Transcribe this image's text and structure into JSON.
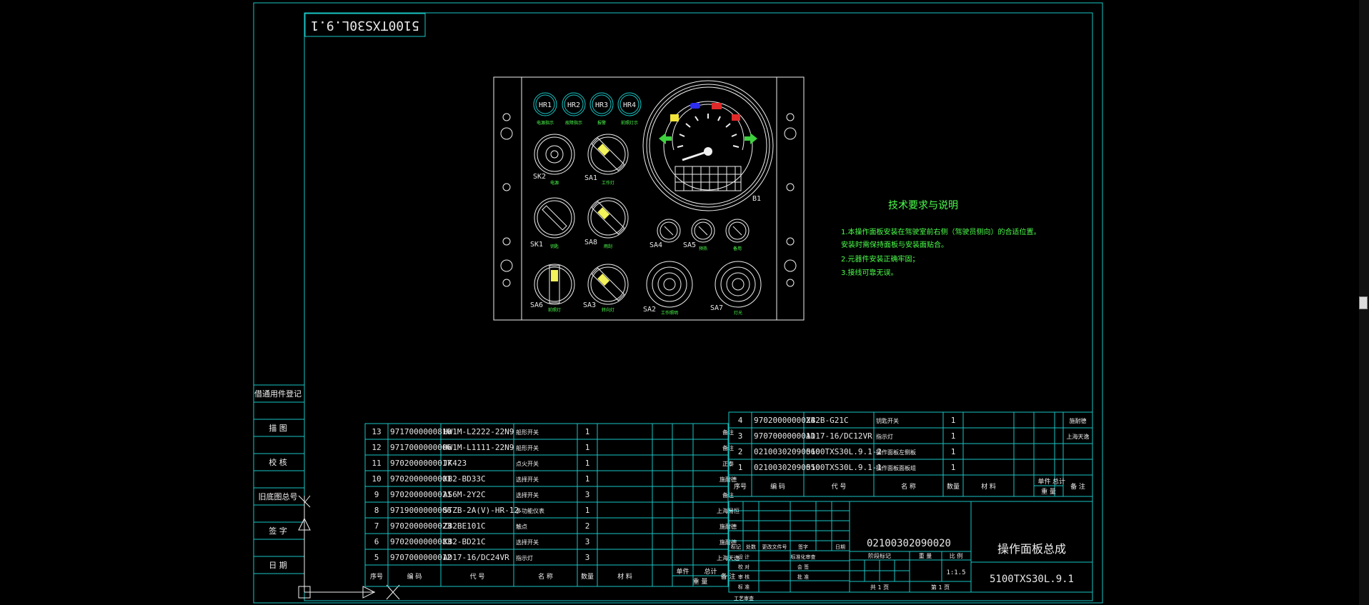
{
  "title_tag": "5100TXS30L.9.1",
  "tech": {
    "heading": "技术要求与说明",
    "lines": [
      "1.本操作面板安装在驾驶室前右侧（驾驶员侧向）的合适位置。",
      "   安装时需保持面板与安装面贴合。",
      "2.元器件安装正确牢固；",
      "3.接线可靠无误。"
    ]
  },
  "indicators": [
    "HR1",
    "HR2",
    "HR3",
    "HR4"
  ],
  "indicator_captions": [
    "电源指示",
    "故障指示",
    "报警",
    "前照灯示"
  ],
  "switch_labels": [
    "SK2",
    "SA1",
    "SK1",
    "SA8",
    "SA4",
    "SA5",
    "SA6",
    "SA3",
    "SA2",
    "SA7",
    "B1"
  ],
  "switch_captions": {
    "sk2": "电源",
    "sa1": "工作灯",
    "sk1": "钥匙",
    "sa8": "雨刮",
    "sa6": "前照灯",
    "sa3": "转向灯",
    "sa2": "工作照明",
    "sa7": "灯光",
    "sa4": "喇叭",
    "sa5": "预热",
    "sa6b": "备用"
  },
  "side_panel": [
    "借通用件登记",
    "描 图",
    "校 核",
    "旧底图总号",
    "签 字",
    "日 期"
  ],
  "bom_left": {
    "header": [
      "序号",
      "编 码",
      "代 号",
      "名 称",
      "数量",
      "材 料",
      "单件",
      "总计",
      "备 注"
    ],
    "header_weight": "重 量",
    "rows": [
      {
        "no": "13",
        "code": "9717000000810",
        "part": "HW1M-L2222-22N9",
        "name": "船形开关",
        "qty": "1",
        "note": "备注"
      },
      {
        "no": "12",
        "code": "9717000000006",
        "part": "HW1M-L1111-22N9",
        "name": "船形开关",
        "qty": "1",
        "note": "备注"
      },
      {
        "no": "11",
        "code": "9702000000017",
        "part": "JK423",
        "name": "点火开关",
        "qty": "1",
        "note": "正泰"
      },
      {
        "no": "10",
        "code": "9702000000001",
        "part": "XB2-BD33C",
        "name": "选择开关",
        "qty": "1",
        "note": "施耐德"
      },
      {
        "no": "9",
        "code": "9702000000021",
        "part": "AS6M-2Y2C",
        "name": "选择开关",
        "qty": "3",
        "note": "备注"
      },
      {
        "no": "8",
        "code": "9719000000006",
        "part": "STZB-2A(V)-HR-12",
        "name": "多功能仪表",
        "qty": "1",
        "note": "上海易恒"
      },
      {
        "no": "7",
        "code": "9702000000023",
        "part": "ZB2BE101C",
        "name": "触点",
        "qty": "2",
        "note": "施耐德"
      },
      {
        "no": "6",
        "code": "9702000000083",
        "part": "XB2-BD21C",
        "name": "选择开关",
        "qty": "3",
        "note": "施耐德"
      },
      {
        "no": "5",
        "code": "9707000000012",
        "part": "AD17-16/DC24VR",
        "name": "指示灯",
        "qty": "3",
        "note": "上海天逸"
      }
    ]
  },
  "bom_right": {
    "header": [
      "序号",
      "编 码",
      "代 号",
      "名 称",
      "数量",
      "材 料",
      "单件",
      "总计",
      "备 注"
    ],
    "header_weight": "重 量",
    "rows": [
      {
        "no": "4",
        "code": "9702000000024",
        "part": "XB2B-G21C",
        "name": "钥匙开关",
        "qty": "1",
        "note": "施耐德"
      },
      {
        "no": "3",
        "code": "9707000000011",
        "part": "AD17-16/DC12VR",
        "name": "指示灯",
        "qty": "1",
        "note": "上海天逸"
      },
      {
        "no": "2",
        "code": "02100302090060",
        "part": "5100TXS30L.9.1-2",
        "name": "操作面板左侧板",
        "qty": "1",
        "note": ""
      },
      {
        "no": "1",
        "code": "02100302090050",
        "part": "5100TXS30L.9.1-1",
        "name": "操作面板面板组",
        "qty": "1",
        "note": ""
      }
    ]
  },
  "title_block": {
    "drawing_no": "02100302090020",
    "name": "操作面板总成",
    "code": "5100TXS30L.9.1",
    "scale": "1:1.5",
    "stage_label": "阶段标记",
    "weight_label": "重 量",
    "scale_label": "比 例",
    "sheets": "共 1 页",
    "sheet": "第 1 页",
    "rev_labels": [
      "标记",
      "处数",
      "更改文件号",
      "签字",
      "日期"
    ],
    "sign_labels": [
      "设 计",
      "校 对",
      "审 核",
      "标 准",
      "批 准",
      "工艺审查"
    ],
    "std_labels": [
      "标准化审查",
      "会 签",
      "批 准"
    ]
  }
}
